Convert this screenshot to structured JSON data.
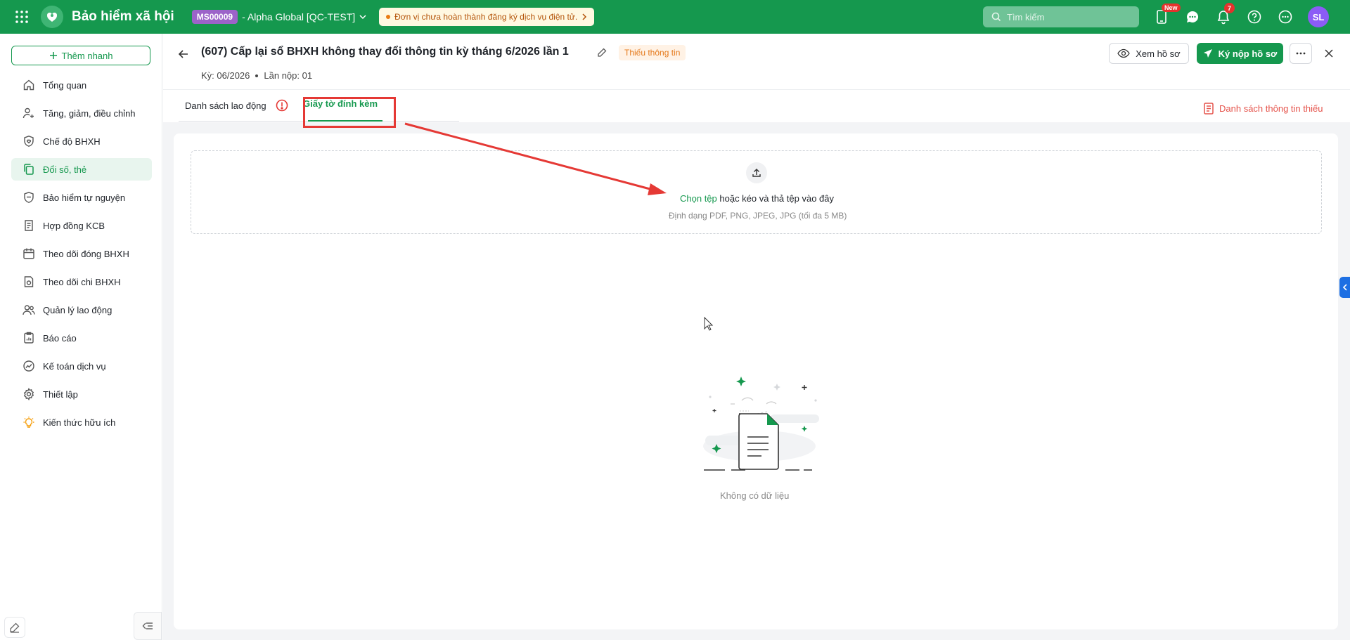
{
  "topbar": {
    "app_title": "Bảo hiểm xã hội",
    "org_code": "MS00009",
    "org_name": "- Alpha Global [QC-TEST]",
    "warning": "Đơn vị chưa hoàn thành đăng ký dịch vụ điện tử.",
    "search_placeholder": "Tìm kiếm",
    "new_badge": "New",
    "notification_count": "7",
    "avatar_initials": "SL",
    "brand_color": "#15984e"
  },
  "sidebar": {
    "quick_add": "Thêm nhanh",
    "items": [
      {
        "label": "Tổng quan",
        "icon": "home-icon"
      },
      {
        "label": "Tăng, giảm, điều chỉnh",
        "icon": "user-plus-icon"
      },
      {
        "label": "Chế độ BHXH",
        "icon": "shield-heart-icon"
      },
      {
        "label": "Đổi số, thẻ",
        "icon": "copy-icon",
        "active": true
      },
      {
        "label": "Bảo hiểm tự nguyện",
        "icon": "shield-icon"
      },
      {
        "label": "Hợp đồng KCB",
        "icon": "contract-icon"
      },
      {
        "label": "Theo dõi đóng BHXH",
        "icon": "calendar-icon"
      },
      {
        "label": "Theo dõi chi BHXH",
        "icon": "document-money-icon"
      },
      {
        "label": "Quản lý lao động",
        "icon": "users-icon"
      },
      {
        "label": "Báo cáo",
        "icon": "report-icon"
      },
      {
        "label": "Kế toán dịch vụ",
        "icon": "chart-circle-icon"
      },
      {
        "label": "Thiết lập",
        "icon": "gear-icon"
      },
      {
        "label": "Kiến thức hữu ích",
        "icon": "lightbulb-icon"
      }
    ]
  },
  "header": {
    "title": "(607) Cấp lại sổ BHXH không thay đổi thông tin kỳ tháng 6/2026 lần 1",
    "status": "Thiếu thông tin",
    "period": "Kỳ: 06/2026",
    "submission": "Lần nộp: 01",
    "view_button": "Xem hồ sơ",
    "submit_button": "Ký nộp hồ sơ"
  },
  "tabs": {
    "employees": "Danh sách lao động",
    "attachments": "Giấy tờ đính kèm",
    "missing_info": "Danh sách thông tin thiếu"
  },
  "upload": {
    "choose": "Chọn tệp",
    "drag_text": " hoặc kéo và thả tệp vào đây",
    "hint": "Định dạng PDF, PNG, JPEG, JPG (tối đa 5 MB)"
  },
  "empty": {
    "text": "Không có dữ liệu"
  }
}
